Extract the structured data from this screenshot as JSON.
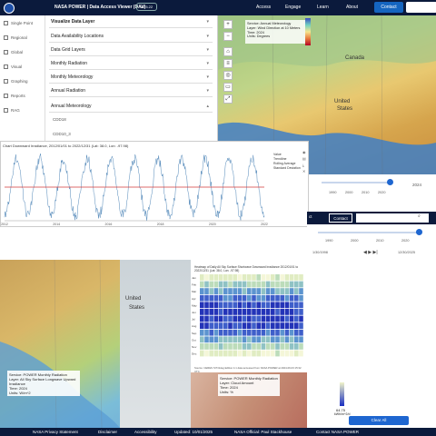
{
  "header": {
    "title": "NASA POWER | Data Access Viewer (DAV)",
    "version_badge": "v2.5.22",
    "nav": [
      "Access",
      "Engage",
      "Learn",
      "About"
    ],
    "contact": "Contact"
  },
  "sidebar": {
    "items": [
      "Single Point",
      "Regional",
      "Global",
      "Visual",
      "Graphing",
      "Reports",
      "RAG"
    ]
  },
  "layers": {
    "header": "Visualize Data Layer",
    "rows": [
      "Data Availability Locations",
      "Data Grid Layers",
      "Monthly Radiation",
      "Monthly Meteorology",
      "Annual Radiation",
      "Annual Meteorology"
    ],
    "sub_items": [
      "CDD18",
      "CDD10_3"
    ]
  },
  "map1": {
    "info": [
      "Service: Annual Meteorology",
      "Layer: Wind Direction at 10 Meters",
      "Time: 2024",
      "Units: Degrees"
    ],
    "labels": {
      "canada": "Canada",
      "united": "United",
      "states": "States",
      "mexico": "Mexico"
    }
  },
  "slider1": {
    "years": [
      "1990",
      "2000",
      "2010",
      "2020"
    ],
    "current": "2024"
  },
  "chart": {
    "title": "Chart Downward Irradiance, 2012/01/01 to 2022/12/31 (Lat: 38.0, Lon: -97.98)",
    "legend": [
      "Value",
      "Trendline",
      "Rolling Average",
      "Standard Deviation"
    ],
    "x_ticks": [
      "2012",
      "2014",
      "2016",
      "2018",
      "2020",
      "2022"
    ]
  },
  "chart_data": {
    "type": "line",
    "x": [
      "2012",
      "2013",
      "2014",
      "2015",
      "2016",
      "2017",
      "2018",
      "2019",
      "2020",
      "2021",
      "2022"
    ],
    "series": [
      {
        "name": "Value",
        "values": [
          5.0,
          5.1,
          4.9,
          5.0,
          5.1,
          5.0,
          4.9,
          5.0,
          5.1,
          5.0,
          5.0
        ]
      },
      {
        "name": "Trendline",
        "values": [
          5.0,
          5.0,
          5.0,
          5.0,
          5.0,
          5.0,
          5.0,
          5.0,
          5.0,
          5.0,
          5.0
        ]
      }
    ],
    "ylim": [
      0,
      10
    ],
    "legend": "top-right"
  },
  "panel2": {
    "contact": "Contact",
    "dates": [
      "1/30/1998",
      "12/30/2025"
    ],
    "years": [
      "1990",
      "2000",
      "2010",
      "2020"
    ]
  },
  "heatmap": {
    "title": "Heatmap of Daily All Sky Surface Shortwave Downward Irradiance 2012/01/01 to 2022/12/31 (Lat: 38.0, Lon: -97.98)",
    "months": [
      "Jan",
      "Feb",
      "Mar",
      "Apr",
      "May",
      "Jun",
      "Jul",
      "Aug",
      "Sep",
      "Oct",
      "Nov",
      "Dec"
    ],
    "source": "Source: CERES SYN1deg Edition 4.1 data accessed from NASA POWER at 2024-09-03 15:32 UTC"
  },
  "map2": {
    "labels": {
      "united": "United",
      "states": "States"
    },
    "info": [
      "Service: POWER Monthly Radiation",
      "Layer: All Sky Surface Longwave Upward Irradiance",
      "Time: 2024",
      "Units: W/m^2"
    ],
    "info3": [
      "Service: POWER Monthly Radiation",
      "Layer: Cloud Amount",
      "Time: 2024",
      "Units: %"
    ]
  },
  "legend2": {
    "value": "64.75",
    "unit": "kWh/m^2/d",
    "clear": "Clear All"
  },
  "footer": [
    "NASA Privacy Statement",
    "Disclaimer",
    "Accessibility",
    "Updated: 10/01/2025",
    "NASA Official: Paul Stackhouse",
    "Contact NASA POWER"
  ],
  "colors": {
    "navy": "#0b1a3c",
    "accent": "#1565c0",
    "trend": "#d33a3a"
  }
}
